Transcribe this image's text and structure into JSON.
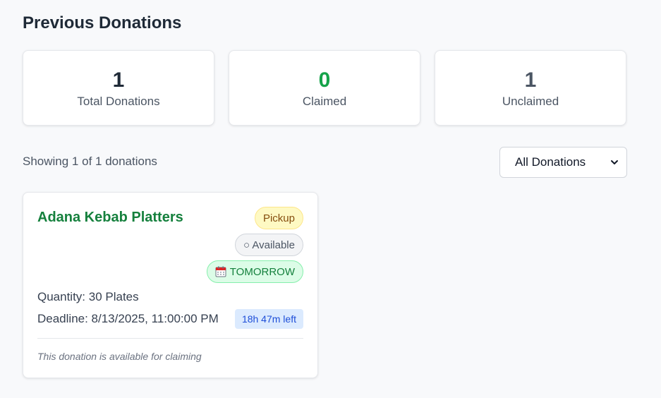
{
  "page": {
    "title": "Previous Donations"
  },
  "stats": [
    {
      "value": "1",
      "label": "Total Donations",
      "color": "#1f2a37"
    },
    {
      "value": "0",
      "label": "Claimed",
      "color": "#16a34a"
    },
    {
      "value": "1",
      "label": "Unclaimed",
      "color": "#4b5563"
    }
  ],
  "list": {
    "showing_text": "Showing 1 of 1 donations"
  },
  "filter": {
    "selected": "All Donations"
  },
  "donation": {
    "title": "Adana Kebab Platters",
    "badges": {
      "pickup": "Pickup",
      "status": "○ Available",
      "when_icon": "calendar-icon",
      "when": "TOMORROW"
    },
    "quantity": "Quantity: 30 Plates",
    "deadline": "Deadline: 8/13/2025, 11:00:00 PM",
    "time_left": "18h 47m left",
    "note": "This donation is available for claiming"
  }
}
